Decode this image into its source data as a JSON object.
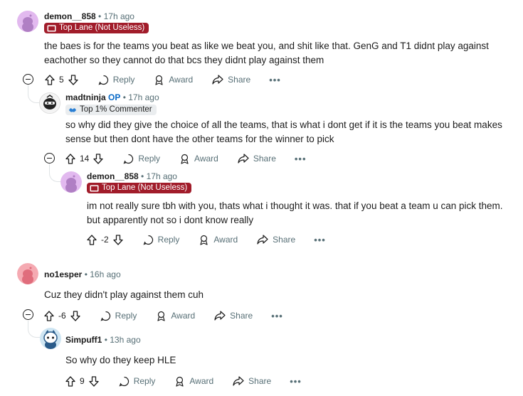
{
  "comments": [
    {
      "username": "demon__858",
      "time": "17h ago",
      "flair": "Top Lane (Not Useless)",
      "body_lines": [
        "the baes is for the teams you beat as like we beat you, and shit like that. GenG and T1 didnt play against",
        "eachother so they cannot do that bcs they didnt play against them"
      ],
      "votes": "5"
    },
    {
      "username": "madtninja",
      "op_label": "OP",
      "time": "17h ago",
      "flair": "Top 1% Commenter",
      "body_lines": [
        "so why did they give the choice of all the teams, that is what i dont get if it is the teams you beat makes",
        "sense but then dont have the other teams for the winner to pick"
      ],
      "votes": "14"
    },
    {
      "username": "demon__858",
      "time": "17h ago",
      "flair": "Top Lane (Not Useless)",
      "body_lines": [
        "im not really sure tbh with you, thats what i thought it was. that if you beat a team u can pick them.",
        "but apparently not so i dont know really"
      ],
      "votes": "-2"
    },
    {
      "username": "no1esper",
      "time": "16h ago",
      "body_lines": [
        "Cuz they didn't play against them cuh"
      ],
      "votes": "-6"
    },
    {
      "username": "Simpuff1",
      "time": "13h ago",
      "body_lines": [
        "So why do they keep HLE"
      ],
      "votes": "9"
    }
  ],
  "actions": {
    "reply": "Reply",
    "award": "Award",
    "share": "Share",
    "more": "•••"
  },
  "separator": "•",
  "colors": {
    "flair_red": "#a11c2a",
    "op_blue": "#0a6ac7",
    "avatar_purple": "#d8a6e8",
    "avatar_pink": "#f4a3ac"
  }
}
